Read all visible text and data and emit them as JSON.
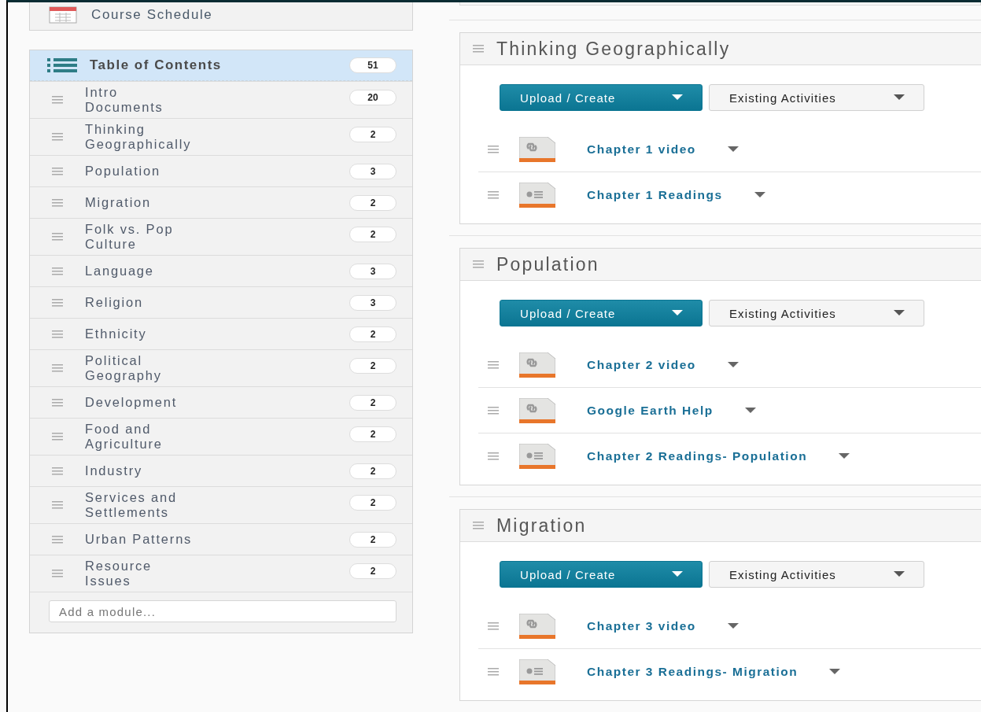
{
  "sidebar": {
    "course_schedule": {
      "label": "Course Schedule"
    },
    "toc": {
      "label": "Table of Contents",
      "count": "51",
      "selected": true
    },
    "modules": [
      {
        "label": "Intro Documents",
        "count": "20",
        "selected": false
      },
      {
        "label": "Thinking Geographically",
        "count": "2",
        "selected": false
      },
      {
        "label": "Population",
        "count": "3",
        "selected": false
      },
      {
        "label": "Migration",
        "count": "2",
        "selected": false
      },
      {
        "label": "Folk vs. Pop Culture",
        "count": "2",
        "selected": false
      },
      {
        "label": "Language",
        "count": "3",
        "selected": false
      },
      {
        "label": "Religion",
        "count": "3",
        "selected": false
      },
      {
        "label": "Ethnicity",
        "count": "2",
        "selected": false
      },
      {
        "label": "Political Geography",
        "count": "2",
        "selected": false
      },
      {
        "label": "Development",
        "count": "2",
        "selected": false
      },
      {
        "label": "Food and Agriculture",
        "count": "2",
        "selected": false
      },
      {
        "label": "Industry",
        "count": "2",
        "selected": false
      },
      {
        "label": "Services and Settlements",
        "count": "2",
        "selected": false
      },
      {
        "label": "Urban Patterns",
        "count": "2",
        "selected": false
      },
      {
        "label": "Resource Issues",
        "count": "2",
        "selected": false
      }
    ],
    "add_module": {
      "placeholder": "Add a module..."
    }
  },
  "sections": [
    {
      "title": "Thinking Geographically",
      "buttons": [
        "Upload / Create",
        "Existing Activities"
      ],
      "items": [
        {
          "title": "Chapter 1 video",
          "kind": "link"
        },
        {
          "title": "Chapter 1 Readings",
          "kind": "document"
        }
      ]
    },
    {
      "title": "Population",
      "buttons": [
        "Upload / Create",
        "Existing Activities"
      ],
      "items": [
        {
          "title": "Chapter 2 video",
          "kind": "link"
        },
        {
          "title": "Google Earth Help",
          "kind": "link"
        },
        {
          "title": "Chapter 2 Readings- Population",
          "kind": "document"
        }
      ]
    },
    {
      "title": "Migration",
      "buttons": [
        "Upload / Create",
        "Existing Activities"
      ],
      "items": [
        {
          "title": "Chapter 3 video",
          "kind": "link"
        },
        {
          "title": "Chapter 3 Readings- Migration",
          "kind": "document"
        }
      ]
    }
  ]
}
